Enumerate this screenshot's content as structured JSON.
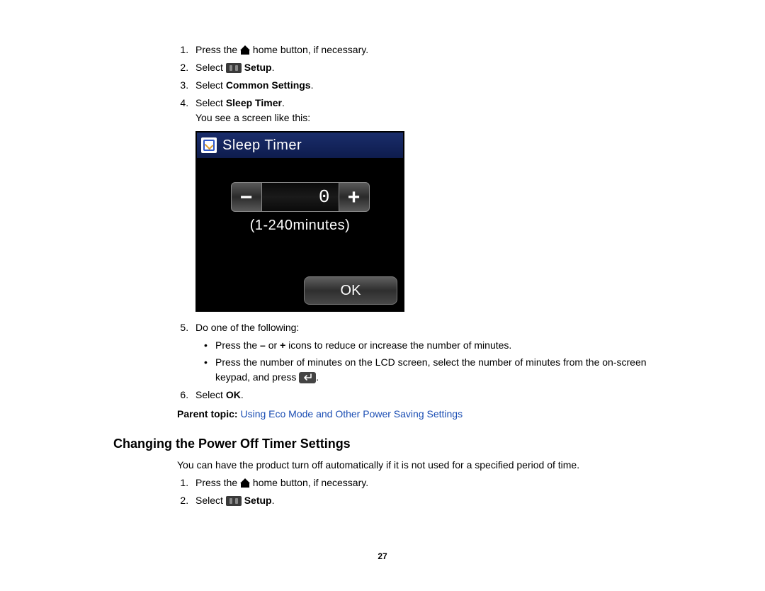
{
  "steps_a": {
    "s1_a": "Press the ",
    "s1_b": " home button, if necessary.",
    "s2_a": "Select ",
    "s2_b": "Setup",
    "s2_c": ".",
    "s3_a": "Select ",
    "s3_b": "Common Settings",
    "s3_c": ".",
    "s4_a": "Select ",
    "s4_b": "Sleep Timer",
    "s4_c": ".",
    "s4_note": "You see a screen like this:",
    "s5": "Do one of the following:",
    "s5_b1_a": "Press the ",
    "s5_b1_b": "–",
    "s5_b1_c": " or ",
    "s5_b1_d": "+",
    "s5_b1_e": " icons to reduce or increase the number of minutes.",
    "s5_b2_a": "Press the number of minutes on the LCD screen, select the number of minutes from the on-screen keypad, and press ",
    "s5_b2_b": ".",
    "s6_a": "Select ",
    "s6_b": "OK",
    "s6_c": "."
  },
  "parent_topic": {
    "label": "Parent topic: ",
    "link": "Using Eco Mode and Other Power Saving Settings"
  },
  "section2": {
    "heading": "Changing the Power Off Timer Settings",
    "desc": "You can have the product turn off automatically if it is not used for a specified period of time.",
    "s1_a": "Press the ",
    "s1_b": " home button, if necessary.",
    "s2_a": "Select ",
    "s2_b": "Setup",
    "s2_c": "."
  },
  "lcd": {
    "title": "Sleep Timer",
    "minus": "−",
    "value": "0",
    "plus": "+",
    "range": "(1-240minutes)",
    "ok": "OK"
  },
  "page_number": "27"
}
